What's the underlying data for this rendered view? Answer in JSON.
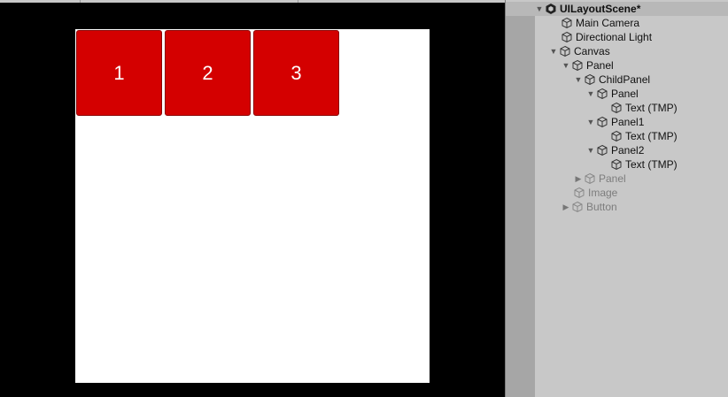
{
  "game_view": {
    "tiles": [
      {
        "label": "1"
      },
      {
        "label": "2"
      },
      {
        "label": "3"
      }
    ],
    "colors": {
      "background": "#000000",
      "canvas": "#ffffff",
      "tile": "#d40000"
    }
  },
  "hierarchy": {
    "scene": {
      "name": "UILayoutScene*",
      "icon": "unity-scene-icon"
    },
    "items": [
      {
        "label": "Main Camera",
        "icon": "gameobject-cube-icon"
      },
      {
        "label": "Directional Light",
        "icon": "gameobject-cube-icon"
      },
      {
        "label": "Canvas",
        "icon": "gameobject-cube-icon",
        "expanded": true
      },
      {
        "label": "Panel",
        "icon": "gameobject-cube-icon",
        "expanded": true
      },
      {
        "label": "ChildPanel",
        "icon": "gameobject-cube-icon",
        "expanded": true
      },
      {
        "label": "Panel",
        "icon": "gameobject-cube-icon",
        "expanded": true
      },
      {
        "label": "Text (TMP)",
        "icon": "gameobject-cube-icon"
      },
      {
        "label": "Panel1",
        "icon": "gameobject-cube-icon",
        "expanded": true
      },
      {
        "label": "Text (TMP)",
        "icon": "gameobject-cube-icon"
      },
      {
        "label": "Panel2",
        "icon": "gameobject-cube-icon",
        "expanded": true
      },
      {
        "label": "Text (TMP)",
        "icon": "gameobject-cube-icon"
      },
      {
        "label": "Panel",
        "icon": "gameobject-cube-icon",
        "expanded": false,
        "inactive": true
      },
      {
        "label": "Image",
        "icon": "gameobject-cube-icon",
        "inactive": true
      },
      {
        "label": "Button",
        "icon": "gameobject-cube-icon",
        "expanded": false,
        "inactive": true
      }
    ]
  }
}
